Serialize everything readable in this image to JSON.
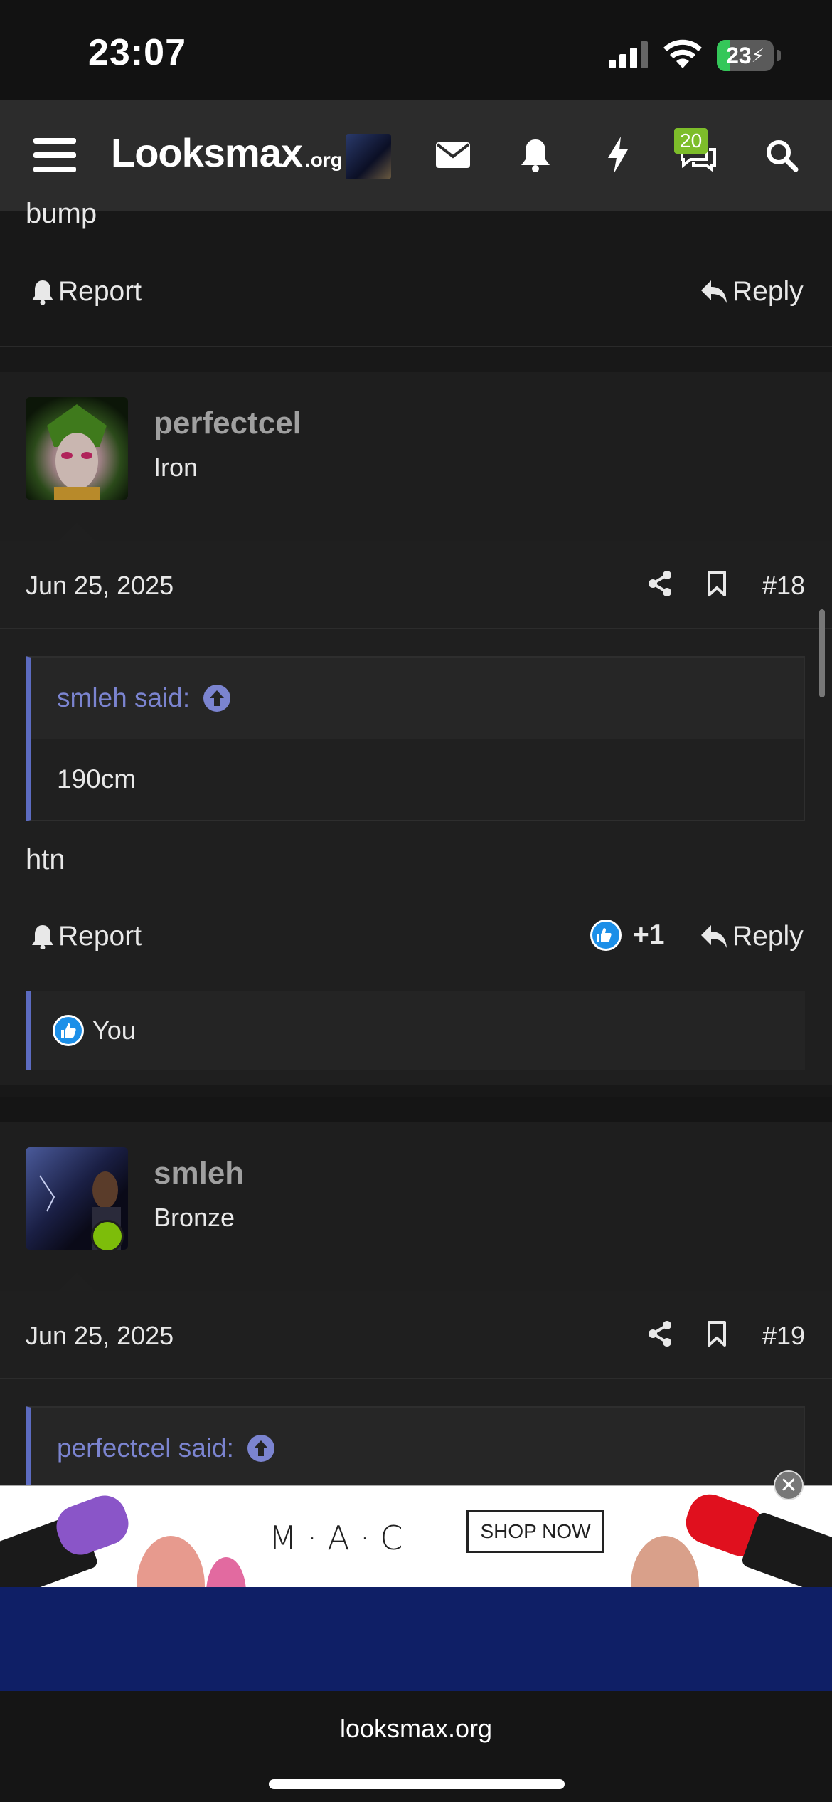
{
  "status_bar": {
    "time": "23:07",
    "battery": "23",
    "battery_level": 0.23
  },
  "nav": {
    "logo_main": "Looksmax",
    "logo_suffix": ".org",
    "chat_badge": "20"
  },
  "prev_post": {
    "text": "bump",
    "report_label": "Report",
    "reply_label": "Reply"
  },
  "post18": {
    "username": "perfectcel",
    "rank": "Iron",
    "date": "Jun 25, 2025",
    "number": "#18",
    "quote_author": "smleh said:",
    "quote_text": "190cm",
    "text": "htn",
    "report_label": "Report",
    "reaction_count": "+1",
    "reply_label": "Reply",
    "reaction_by": "You"
  },
  "post19": {
    "username": "smleh",
    "rank": "Bronze",
    "date": "Jun 25, 2025",
    "number": "#19",
    "quote_author": "perfectcel said:"
  },
  "ad": {
    "brand": "M·A·C",
    "cta": "SHOP NOW",
    "close": "✕"
  },
  "browser": {
    "url": "looksmax.org"
  },
  "colors": {
    "accent": "#5c6bc0",
    "online": "#7dbd0a",
    "like": "#1c8fe8"
  }
}
